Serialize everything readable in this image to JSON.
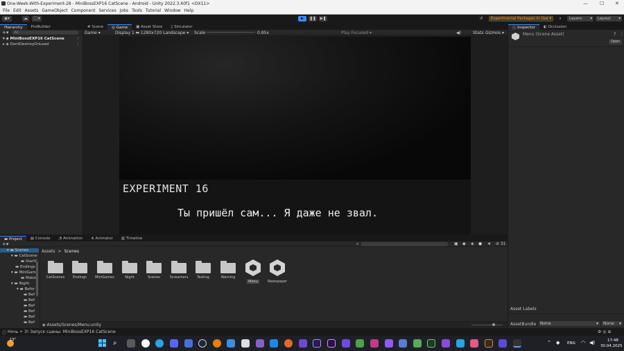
{
  "window": {
    "title": "One-Week-With-Experiment-28 - MiniBossEXP16 CatScene - Android - Unity 2022.3.60f1 <DX11>"
  },
  "menu": [
    "File",
    "Edit",
    "Assets",
    "GameObject",
    "Component",
    "Services",
    "Jobs",
    "Tools",
    "Tutorial",
    "Window",
    "Help"
  ],
  "toolbar": {
    "experimental": "Experimental Packages In Use ▾",
    "layers": "Layers",
    "layout": "Layout"
  },
  "hierarchy": {
    "tabs": [
      "Hierarchy",
      "ProBuilder"
    ],
    "search_placeholder": "All",
    "items": [
      "MiniBossEXP16 CatScene",
      "DontDestroyOnLoad"
    ]
  },
  "scene_tabs": [
    "Scene",
    "Game",
    "Asset Store",
    "Simulator"
  ],
  "game_bar": {
    "mode": "Game",
    "display": "Display 1",
    "resolution": "1280x720 Landscape",
    "scale_label": "Scale",
    "scale_value": "0.85x",
    "play_focused": "Play Focused",
    "stats": "Stats",
    "gizmos": "Gizmos"
  },
  "game_view": {
    "speaker": "EXPERIMENT 16",
    "dialogue": "Ты пришёл сам... Я даже не звал."
  },
  "inspector": {
    "tabs": [
      "Inspector",
      "Occlusion"
    ],
    "asset_name": "Menu (Scene Asset)",
    "open_label": "Open",
    "asset_labels": "Asset Labels",
    "asset_bundle_label": "AssetBundle",
    "bundle_value": "None",
    "variant_value": "None"
  },
  "bottom_tabs": [
    "Project",
    "Console",
    "Animation",
    "Animator",
    "Timeline"
  ],
  "project": {
    "breadcrumb": [
      "Assets",
      "Scenes"
    ],
    "hidden_count": "31",
    "tree": [
      "Scenes",
      "CatScene",
      "StartC",
      "Endings",
      "MiniGam",
      "Maksi",
      "Night",
      "Befor",
      "Bef",
      "Bef",
      "Bef",
      "Bef",
      "Bef",
      "Bef"
    ],
    "assets": [
      {
        "name": "CatScenes",
        "kind": "folder"
      },
      {
        "name": "Endings",
        "kind": "folder"
      },
      {
        "name": "MiniGames",
        "kind": "folder"
      },
      {
        "name": "Night",
        "kind": "folder"
      },
      {
        "name": "Scenes",
        "kind": "folder"
      },
      {
        "name": "Screamers",
        "kind": "folder"
      },
      {
        "name": "Testing",
        "kind": "folder"
      },
      {
        "name": "Warning",
        "kind": "folder"
      },
      {
        "name": "Menu",
        "kind": "unity"
      },
      {
        "name": "Newspaper",
        "kind": "unity"
      }
    ],
    "footer_path": "Assets/Scenes/Menu.unity"
  },
  "statusbar": {
    "message": "Ночь + 3! Запуск сцены: MiniBossEXP16 CatScene"
  },
  "taskbar": {
    "weather": "13°",
    "lang": "ENG",
    "time": "17:48",
    "date": "30.04.2025"
  },
  "colors": {
    "accent": "#3d8bff",
    "panel": "#282828",
    "background": "#191919",
    "highlight_orange": "#f0a030"
  }
}
